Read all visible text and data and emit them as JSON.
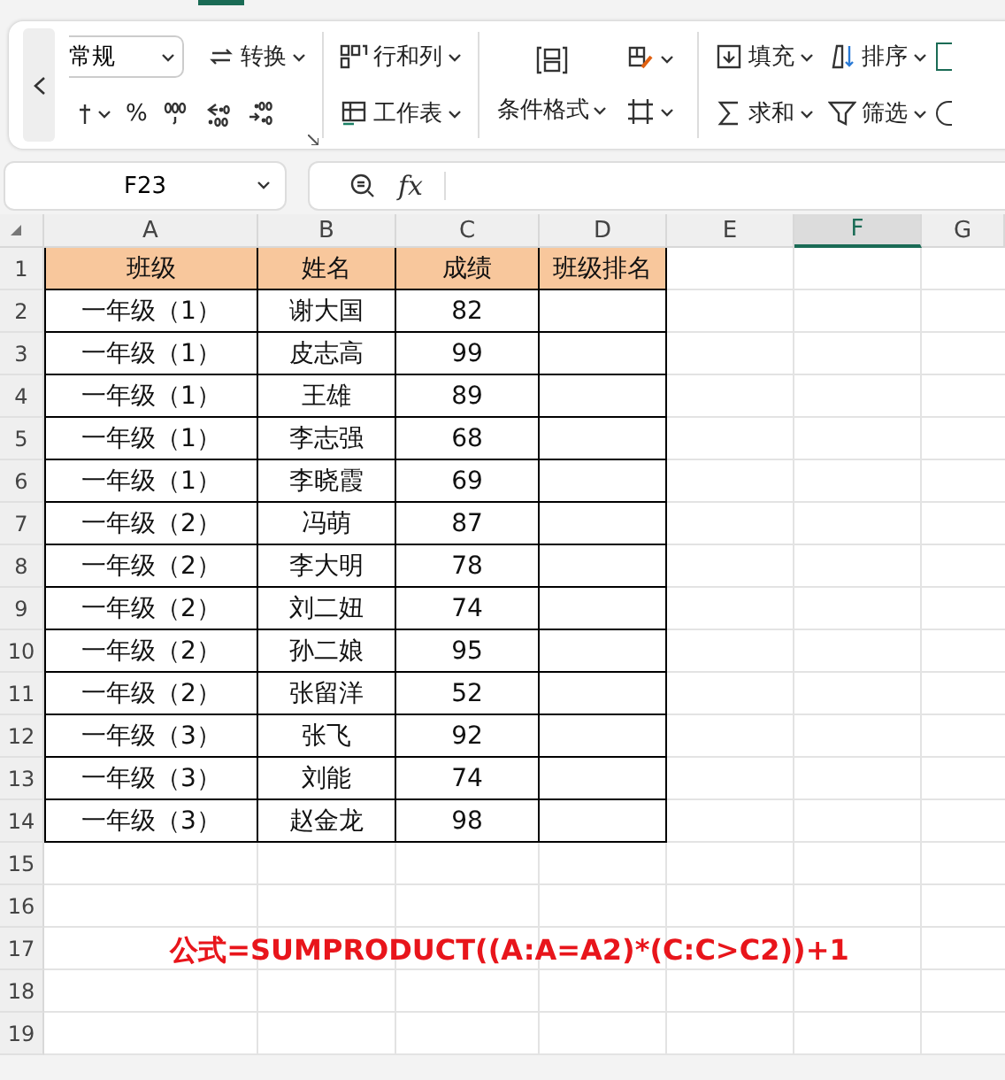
{
  "ribbon": {
    "groups": [
      {
        "kind": "number",
        "format": "常规",
        "convert": "转换",
        "percent": "%"
      },
      {
        "kind": "rowcol",
        "items": [
          "行和列",
          "工作表"
        ]
      },
      {
        "kind": "cond",
        "label": "条件格式"
      },
      {
        "kind": "edit",
        "items": [
          "填充",
          "排序",
          "求和",
          "筛选"
        ]
      }
    ]
  },
  "formula_bar": {
    "name_box": "F23",
    "fx": "fx"
  },
  "sheet": {
    "columns": [
      {
        "label": "A",
        "selected": false
      },
      {
        "label": "B",
        "selected": false
      },
      {
        "label": "C",
        "selected": false
      },
      {
        "label": "D",
        "selected": false
      },
      {
        "label": "E",
        "selected": false
      },
      {
        "label": "F",
        "selected": true
      },
      {
        "label": "G",
        "selected": false
      }
    ],
    "rows": [
      {
        "number": "1",
        "kind": "header",
        "cells": [
          "班级",
          "姓名",
          "成绩",
          "班级排名"
        ]
      },
      {
        "number": "2",
        "kind": "data",
        "cells": [
          "一年级（1）",
          "谢大国",
          "82"
        ]
      },
      {
        "number": "3",
        "kind": "data",
        "cells": [
          "一年级（1）",
          "皮志高",
          "99"
        ]
      },
      {
        "number": "4",
        "kind": "data",
        "cells": [
          "一年级（1）",
          "王雄",
          "89"
        ]
      },
      {
        "number": "5",
        "kind": "data",
        "cells": [
          "一年级（1）",
          "李志强",
          "68"
        ]
      },
      {
        "number": "6",
        "kind": "data",
        "cells": [
          "一年级（1）",
          "李晓霞",
          "69"
        ]
      },
      {
        "number": "7",
        "kind": "data",
        "cells": [
          "一年级（2）",
          "冯萌",
          "87"
        ]
      },
      {
        "number": "8",
        "kind": "data",
        "cells": [
          "一年级（2）",
          "李大明",
          "78"
        ]
      },
      {
        "number": "9",
        "kind": "data",
        "cells": [
          "一年级（2）",
          "刘二妞",
          "74"
        ]
      },
      {
        "number": "10",
        "kind": "data",
        "cells": [
          "一年级（2）",
          "孙二娘",
          "95"
        ]
      },
      {
        "number": "11",
        "kind": "data",
        "cells": [
          "一年级（2）",
          "张留洋",
          "52"
        ]
      },
      {
        "number": "12",
        "kind": "data",
        "cells": [
          "一年级（3）",
          "张飞",
          "92"
        ]
      },
      {
        "number": "13",
        "kind": "data",
        "cells": [
          "一年级（3）",
          "刘能",
          "74"
        ]
      },
      {
        "number": "14",
        "kind": "data",
        "cells": [
          "一年级（3）",
          "赵金龙",
          "98"
        ]
      },
      {
        "number": "15",
        "kind": "empty"
      },
      {
        "number": "16",
        "kind": "empty"
      },
      {
        "number": "17",
        "kind": "empty"
      },
      {
        "number": "18",
        "kind": "empty"
      },
      {
        "number": "19",
        "kind": "empty"
      }
    ],
    "note": "公式=SUMPRODUCT((A:A=A2)*(C:C>C2))+1"
  }
}
